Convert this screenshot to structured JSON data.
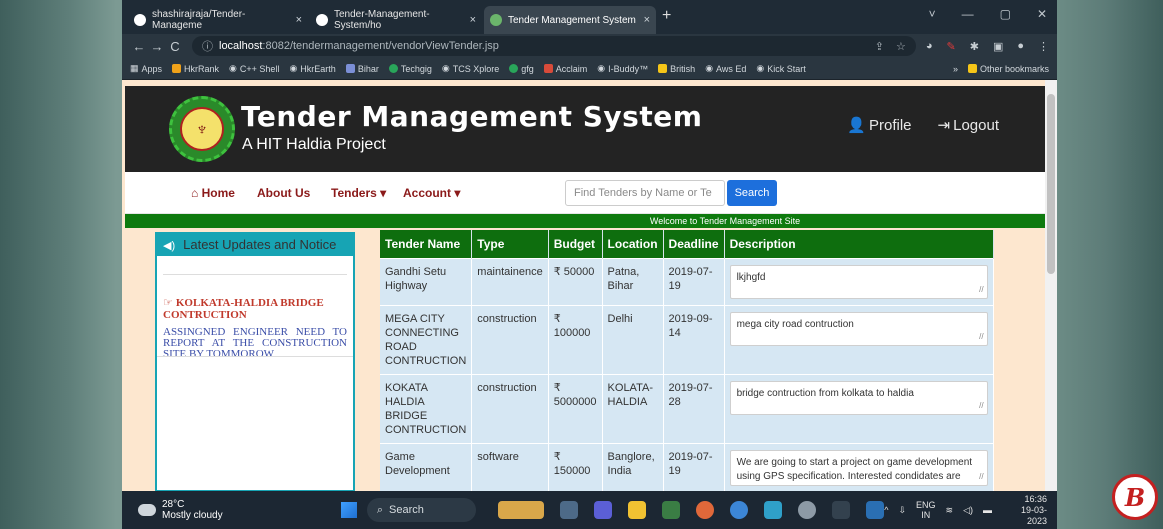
{
  "browser": {
    "tabs": [
      {
        "label": "shashirajraja/Tender-Manageme",
        "close": "×"
      },
      {
        "label": "Tender-Management-System/ho",
        "close": "×"
      },
      {
        "label": "Tender Management System",
        "close": "×"
      }
    ],
    "new_tab": "+",
    "window_controls": [
      "˅",
      "—",
      "▢",
      "✕"
    ],
    "nav": {
      "back": "←",
      "forward": "→",
      "reload": "C"
    },
    "url_host": "localhost",
    "url_rest": ":8082/tendermanagement/vendorViewTender.jsp",
    "bookmarks": [
      {
        "label": "Apps",
        "icon": "apps-icon"
      },
      {
        "label": "HkrRank",
        "icon": "hackerrank-icon"
      },
      {
        "label": "C++ Shell",
        "icon": "globe-icon"
      },
      {
        "label": "HkrEarth",
        "icon": "globe-icon"
      },
      {
        "label": "Bihar",
        "icon": "bihar-icon"
      },
      {
        "label": "Techgig",
        "icon": "whatsapp-icon"
      },
      {
        "label": "TCS Xplore",
        "icon": "globe-icon"
      },
      {
        "label": "gfg",
        "icon": "gfg-icon"
      },
      {
        "label": "Acclaim",
        "icon": "acclaim-icon"
      },
      {
        "label": "I-Buddy™",
        "icon": "globe-icon"
      },
      {
        "label": "British",
        "icon": "british-icon"
      },
      {
        "label": "Aws Ed",
        "icon": "globe-icon"
      },
      {
        "label": "Kick Start",
        "icon": "globe-icon"
      }
    ],
    "bookmarks_more": "»",
    "other_bookmarks": "Other bookmarks"
  },
  "site": {
    "title": "Tender Management System",
    "subtitle": "A HIT Haldia Project",
    "profile_label": "Profile",
    "logout_label": "Logout",
    "nav": {
      "home": "Home",
      "about": "About Us",
      "tenders": "Tenders",
      "account": "Account",
      "search_placeholder": "Find Tenders by Name or Te",
      "search_button": "Search"
    },
    "welcome": "Welcome to Tender Management Site"
  },
  "notice": {
    "heading": "Latest Updates and Notice",
    "title": "KOLKATA-HALDIA BRIDGE CONTRUCTION",
    "text": "ASSINGNED ENGINEER NEED TO REPORT AT THE CONSTRUCTION SITE BY TOMMOROW"
  },
  "table": {
    "headers": [
      "Tender Name",
      "Type",
      "Budget",
      "Location",
      "Deadline",
      "Description"
    ],
    "rows": [
      {
        "name": "Gandhi Setu Highway",
        "type": "maintainence",
        "budget": "₹ 50000",
        "location": "Patna, Bihar",
        "deadline": "2019-07-19",
        "description": "lkjhgfd"
      },
      {
        "name": "MEGA CITY CONNECTING ROAD CONTRUCTION",
        "type": "construction",
        "budget": "₹ 100000",
        "location": "Delhi",
        "deadline": "2019-09-14",
        "description": "mega city road contruction"
      },
      {
        "name": "KOKATA HALDIA BRIDGE CONTRUCTION",
        "type": "construction",
        "budget": "₹ 5000000",
        "location": "KOLATA-HALDIA",
        "deadline": "2019-07-28",
        "description": "bridge contruction from kolkata to haldia"
      },
      {
        "name": "Game Development",
        "type": "software",
        "budget": "₹ 150000",
        "location": "Banglore, India",
        "deadline": "2019-07-19",
        "description": "We are going to start a project on game development using GPS specification. Interested condidates are"
      }
    ]
  },
  "taskbar": {
    "temp": "28°C",
    "weather": "Mostly cloudy",
    "search": "Search",
    "lang_top": "ENG",
    "lang_bottom": "IN",
    "time": "16:36",
    "date": "19-03-2023"
  }
}
